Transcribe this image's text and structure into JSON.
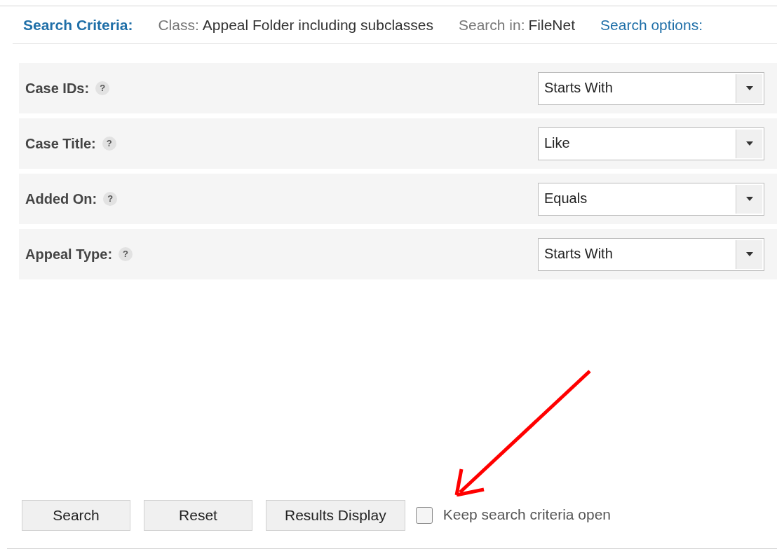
{
  "header": {
    "title": "Search Criteria:",
    "items": [
      {
        "label": "Class:",
        "value": "Appeal Folder including subclasses"
      },
      {
        "label": "Search in:",
        "value": "FileNet"
      }
    ],
    "options_link": "Search options:"
  },
  "criteria": [
    {
      "label": "Case IDs:",
      "help": "?",
      "operator": "Starts With"
    },
    {
      "label": "Case Title:",
      "help": "?",
      "operator": "Like"
    },
    {
      "label": "Added On:",
      "help": "?",
      "operator": "Equals"
    },
    {
      "label": "Appeal Type:",
      "help": "?",
      "operator": "Starts With"
    }
  ],
  "buttons": [
    "Search",
    "Reset",
    "Results Display"
  ],
  "keep_open": {
    "label": "Keep search criteria open",
    "checked": false
  }
}
